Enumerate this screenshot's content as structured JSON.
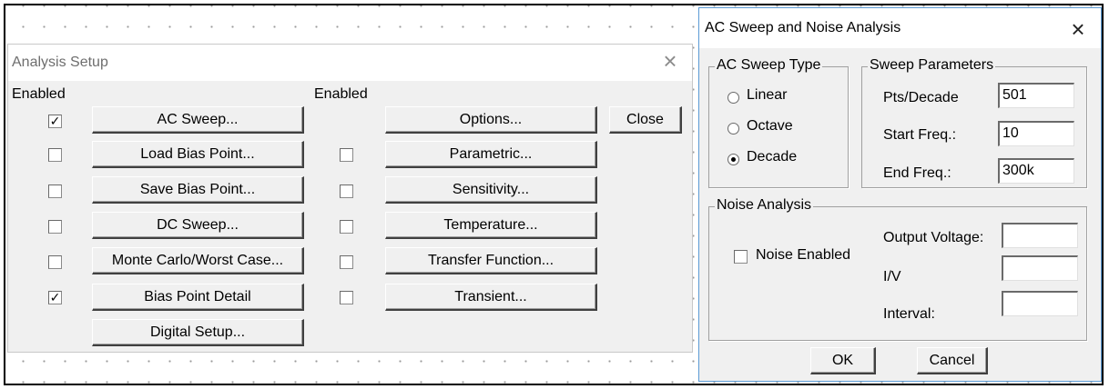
{
  "analysis_setup": {
    "title": "Analysis Setup",
    "close_glyph": "×",
    "enabled_header_left": "Enabled",
    "enabled_header_right": "Enabled",
    "close_label": "Close",
    "left_rows": [
      {
        "label": "AC Sweep...",
        "enabled": true
      },
      {
        "label": "Load Bias Point...",
        "enabled": false
      },
      {
        "label": "Save Bias Point...",
        "enabled": false
      },
      {
        "label": "DC Sweep...",
        "enabled": false
      },
      {
        "label": "Monte Carlo/Worst Case...",
        "enabled": false
      },
      {
        "label": "Bias Point Detail",
        "enabled": true
      },
      {
        "label": "Digital Setup..."
      }
    ],
    "right_rows": [
      {
        "label": "Options..."
      },
      {
        "label": "Parametric...",
        "enabled": false
      },
      {
        "label": "Sensitivity...",
        "enabled": false
      },
      {
        "label": "Temperature...",
        "enabled": false
      },
      {
        "label": "Transfer Function...",
        "enabled": false
      },
      {
        "label": "Transient...",
        "enabled": false
      }
    ],
    "check_glyph": "✓"
  },
  "ac_dialog": {
    "title": "AC Sweep and Noise Analysis",
    "close_glyph": "×",
    "sweep_type": {
      "legend": "AC Sweep Type",
      "options": [
        "Linear",
        "Octave",
        "Decade"
      ],
      "selected": "Decade"
    },
    "sweep_params": {
      "legend": "Sweep Parameters",
      "pts_label": "Pts/Decade",
      "pts_value": "501",
      "start_label": "Start Freq.:",
      "start_value": "10",
      "end_label": "End Freq.:",
      "end_value": "300k"
    },
    "noise": {
      "legend": "Noise Analysis",
      "enabled_label": "Noise Enabled",
      "enabled": false,
      "output_label": "Output Voltage:",
      "output_value": "",
      "iv_label": "I/V",
      "iv_value": "",
      "interval_label": "Interval:",
      "interval_value": ""
    },
    "ok_label": "OK",
    "cancel_label": "Cancel"
  }
}
